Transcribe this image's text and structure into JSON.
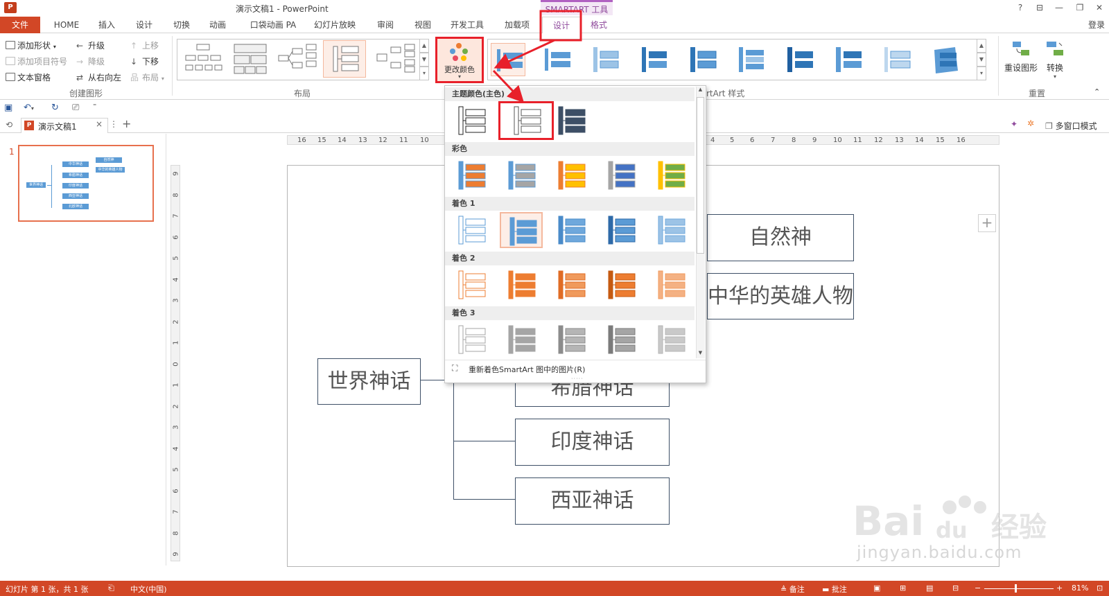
{
  "window": {
    "title": "演示文稿1 - PowerPoint",
    "contextual_tab_group": "SMARTART 工具",
    "help": "?",
    "login": "登录"
  },
  "tabs": [
    {
      "label": "文件"
    },
    {
      "label": "HOME"
    },
    {
      "label": "插入"
    },
    {
      "label": "设计"
    },
    {
      "label": "切换"
    },
    {
      "label": "动画"
    },
    {
      "label": "口袋动画 PA"
    },
    {
      "label": "幻灯片放映"
    },
    {
      "label": "审阅"
    },
    {
      "label": "视图"
    },
    {
      "label": "开发工具"
    },
    {
      "label": "加载项"
    },
    {
      "label": "设计"
    },
    {
      "label": "格式"
    }
  ],
  "ribbon": {
    "create": {
      "add_shape": "添加形状",
      "add_bullet": "添加项目符号",
      "text_pane": "文本窗格",
      "promote": "升级",
      "demote": "降级",
      "right_to_left": "从右向左",
      "move_up": "上移",
      "move_down": "下移",
      "layout": "布局",
      "group_label": "创建图形"
    },
    "layouts_label": "布局",
    "change_colors": "更改颜色",
    "styles_label": "rtArt 样式",
    "reset_graphic": "重设图形",
    "convert": "转换",
    "reset_label": "重置"
  },
  "doc_tab": {
    "name": "演示文稿1",
    "close": "×",
    "more": "⋮",
    "add": "+"
  },
  "right_tools": {
    "multiwindow": "多窗口模式"
  },
  "thumbnail": {
    "slide_number": "1",
    "root": "世界神话",
    "items": [
      "中华神话",
      "希腊神话",
      "印度神话",
      "西亚神话",
      "北欧神话"
    ],
    "subitems": [
      "自然神",
      "中华的英雄人物"
    ]
  },
  "ruler": {
    "h_ticks": [
      "16",
      "15",
      "14",
      "13",
      "12",
      "11",
      "10",
      "4",
      "5",
      "6",
      "7",
      "8",
      "9",
      "10",
      "11",
      "12",
      "13",
      "14",
      "15",
      "16"
    ],
    "v_ticks": [
      "9",
      "8",
      "7",
      "6",
      "5",
      "4",
      "3",
      "2",
      "1",
      "0",
      "1",
      "2",
      "3",
      "4",
      "5",
      "6",
      "7",
      "8",
      "9"
    ]
  },
  "slide": {
    "root": "世界神话",
    "children": [
      "希腊神话",
      "印度神话",
      "西亚神话"
    ],
    "subitems": [
      "自然神",
      "中华的英雄人物"
    ]
  },
  "color_dropdown": {
    "sections": [
      {
        "title": "主题颜色(主色)"
      },
      {
        "title": "彩色"
      },
      {
        "title": "着色 1"
      },
      {
        "title": "着色 2"
      },
      {
        "title": "着色 3"
      }
    ],
    "footer": "重新着色SmartArt 图中的图片(R)",
    "colors": {
      "dark": "#3d4f66",
      "blue": "#5b9bd5",
      "orange": "#ed7d31",
      "gray": "#a5a5a5",
      "gold": "#ffc000",
      "indigo": "#4472c4",
      "green": "#70ad47"
    }
  },
  "status": {
    "slide_info": "幻灯片 第 1 张，共 1 张",
    "language": "中文(中国)",
    "notes": "备注",
    "comments": "批注",
    "zoom": "81%"
  },
  "watermark": {
    "text": "jingyan.baidu.com"
  }
}
